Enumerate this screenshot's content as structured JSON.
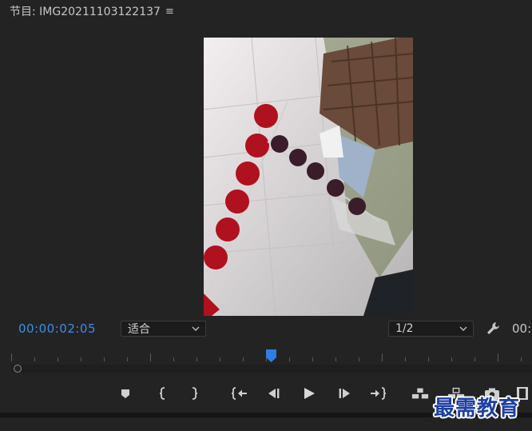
{
  "panel": {
    "title": "节目: IMG20211103122137",
    "menu_icon": "hamburger-icon"
  },
  "monitor": {
    "current_timecode": "00:00:02:05",
    "fit_select": {
      "value": "适合"
    },
    "resolution_select": {
      "value": "1/2"
    },
    "timecode_right": "00:"
  },
  "transport": {
    "buttons": [
      "add-marker-icon",
      "mark-in-icon",
      "mark-out-icon",
      "go-to-in-icon",
      "step-back-icon",
      "play-icon",
      "step-forward-icon",
      "go-to-out-icon",
      "lift-icon",
      "extract-icon",
      "export-frame-icon",
      "more-controls-icon"
    ]
  },
  "watermark": {
    "text": "最需教育"
  },
  "colors": {
    "accent_blue": "#3b8ee6",
    "panel_bg": "#232323"
  }
}
